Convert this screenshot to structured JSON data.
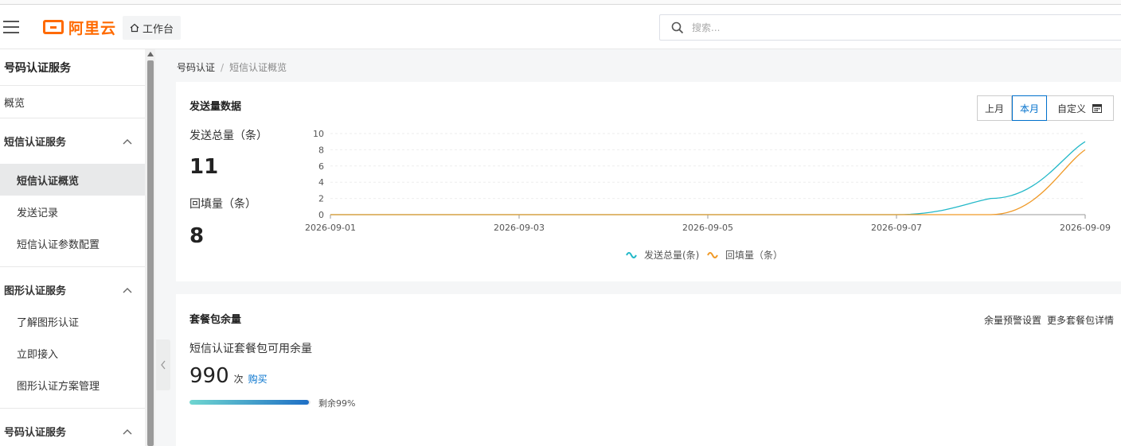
{
  "header": {
    "logo_text": "阿里云",
    "workbench_label": "工作台",
    "search_placeholder": "搜索..."
  },
  "sidebar": {
    "title": "号码认证服务",
    "overview": "概览",
    "groups": [
      {
        "label": "短信认证服务",
        "items": [
          "短信认证概览",
          "发送记录",
          "短信认证参数配置"
        ]
      },
      {
        "label": "图形认证服务",
        "items": [
          "了解图形认证",
          "立即接入",
          "图形认证方案管理"
        ]
      },
      {
        "label": "号码认证服务",
        "items": []
      }
    ],
    "active_item": "短信认证概览"
  },
  "breadcrumb": {
    "parent": "号码认证",
    "separator": "/",
    "current": "短信认证概览"
  },
  "send_card": {
    "title": "发送量数据",
    "range_options": [
      "上月",
      "本月",
      "自定义"
    ],
    "selected_range": "本月",
    "total_label": "发送总量（条）",
    "total_value": "11",
    "backfill_label": "回填量（条）",
    "backfill_value": "8"
  },
  "chart_data": {
    "type": "line",
    "x": [
      "2026-09-01",
      "2026-09-02",
      "2026-09-03",
      "2026-09-04",
      "2026-09-05",
      "2026-09-06",
      "2026-09-07",
      "2026-09-08",
      "2026-09-09"
    ],
    "x_ticks": [
      "2026-09-01",
      "2026-09-03",
      "2026-09-05",
      "2026-09-07",
      "2026-09-09"
    ],
    "y_ticks": [
      0,
      2,
      4,
      6,
      8,
      10
    ],
    "ylim": [
      0,
      10
    ],
    "series": [
      {
        "name": "发送总量(条)",
        "color": "#22b8c8",
        "values": [
          0,
          0,
          0,
          0,
          0,
          0,
          0,
          2,
          9
        ]
      },
      {
        "name": "回填量（条）",
        "color": "#f09a28",
        "values": [
          0,
          0,
          0,
          0,
          0,
          0,
          0,
          0,
          8
        ]
      }
    ],
    "grid": true,
    "legend": "bottom-center"
  },
  "quota_card": {
    "title": "套餐包余量",
    "alert_link": "余量预警设置",
    "more_link": "更多套餐包详情",
    "quota_label": "短信认证套餐包可用余量",
    "quota_value": "990",
    "quota_unit": "次",
    "buy_label": "购买",
    "remaining_percent": 99,
    "remaining_text": "剩余99%"
  }
}
